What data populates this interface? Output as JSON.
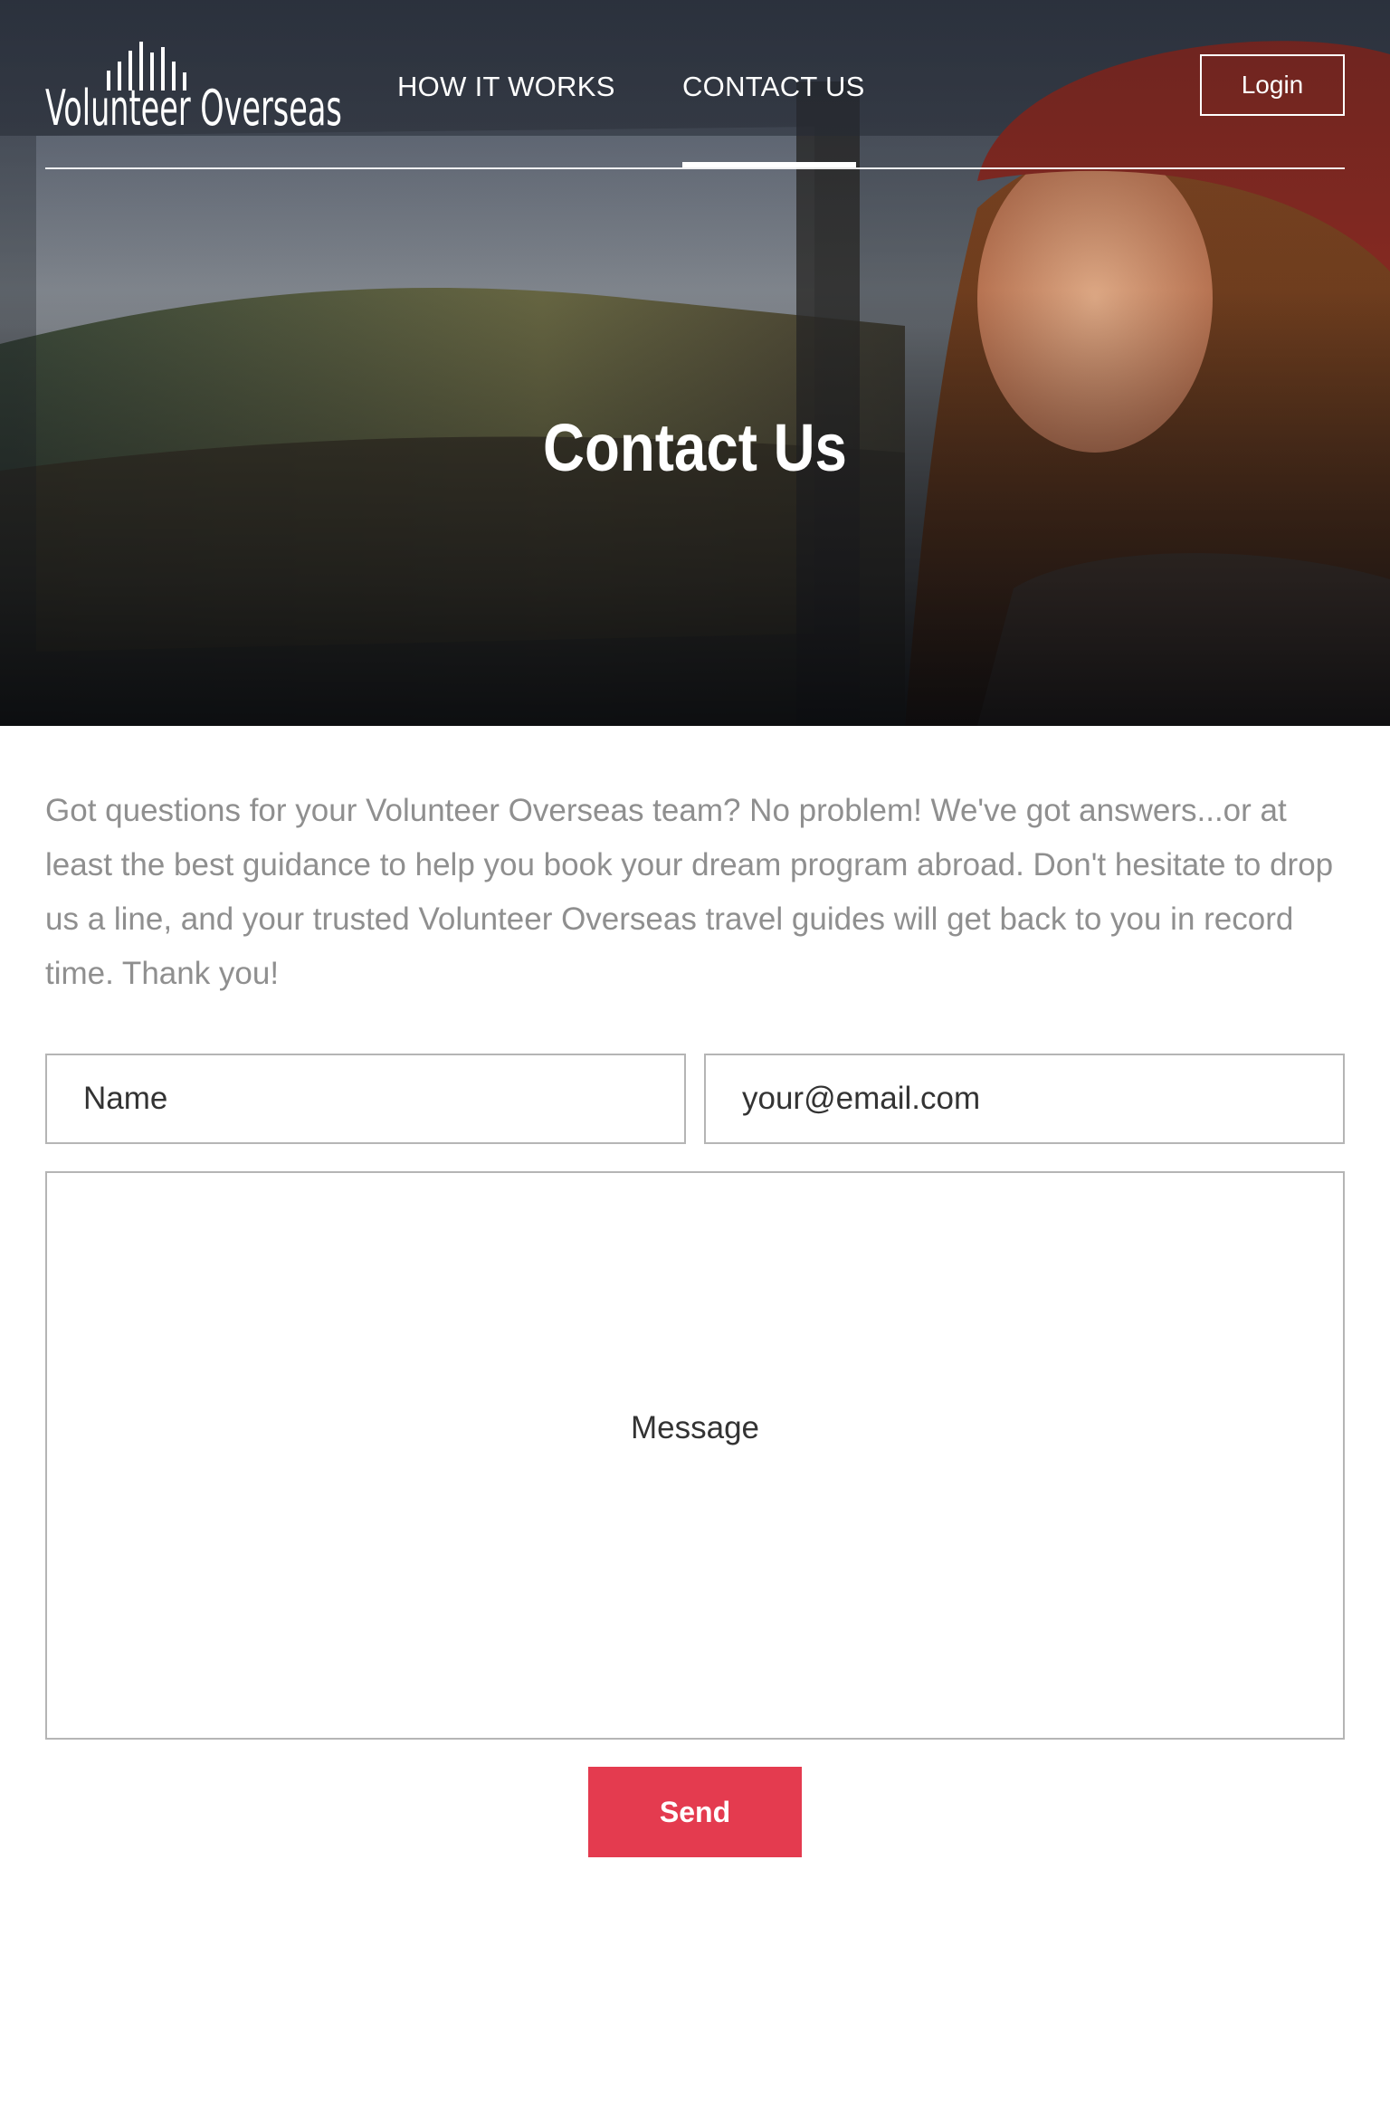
{
  "brand": {
    "name": "Volunteer Overseas"
  },
  "nav": {
    "items": [
      {
        "label": "HOW IT WORKS",
        "active": false
      },
      {
        "label": "CONTACT US",
        "active": true
      }
    ],
    "login_label": "Login"
  },
  "hero": {
    "title": "Contact Us"
  },
  "intro": {
    "text": "Got questions for your Volunteer Overseas team? No problem! We've got answers...or at least the best guidance to help you book your dream program abroad. Don't hesitate to drop us a line, and your trusted Volunteer Overseas travel guides will get back to you in record time. Thank you!"
  },
  "form": {
    "name_placeholder": "Name",
    "email_placeholder": "your@email.com",
    "message_placeholder": "Message",
    "send_label": "Send"
  },
  "colors": {
    "accent": "#e43b4f",
    "intro_text": "#8f8f8f",
    "border": "#b5b5b5"
  }
}
